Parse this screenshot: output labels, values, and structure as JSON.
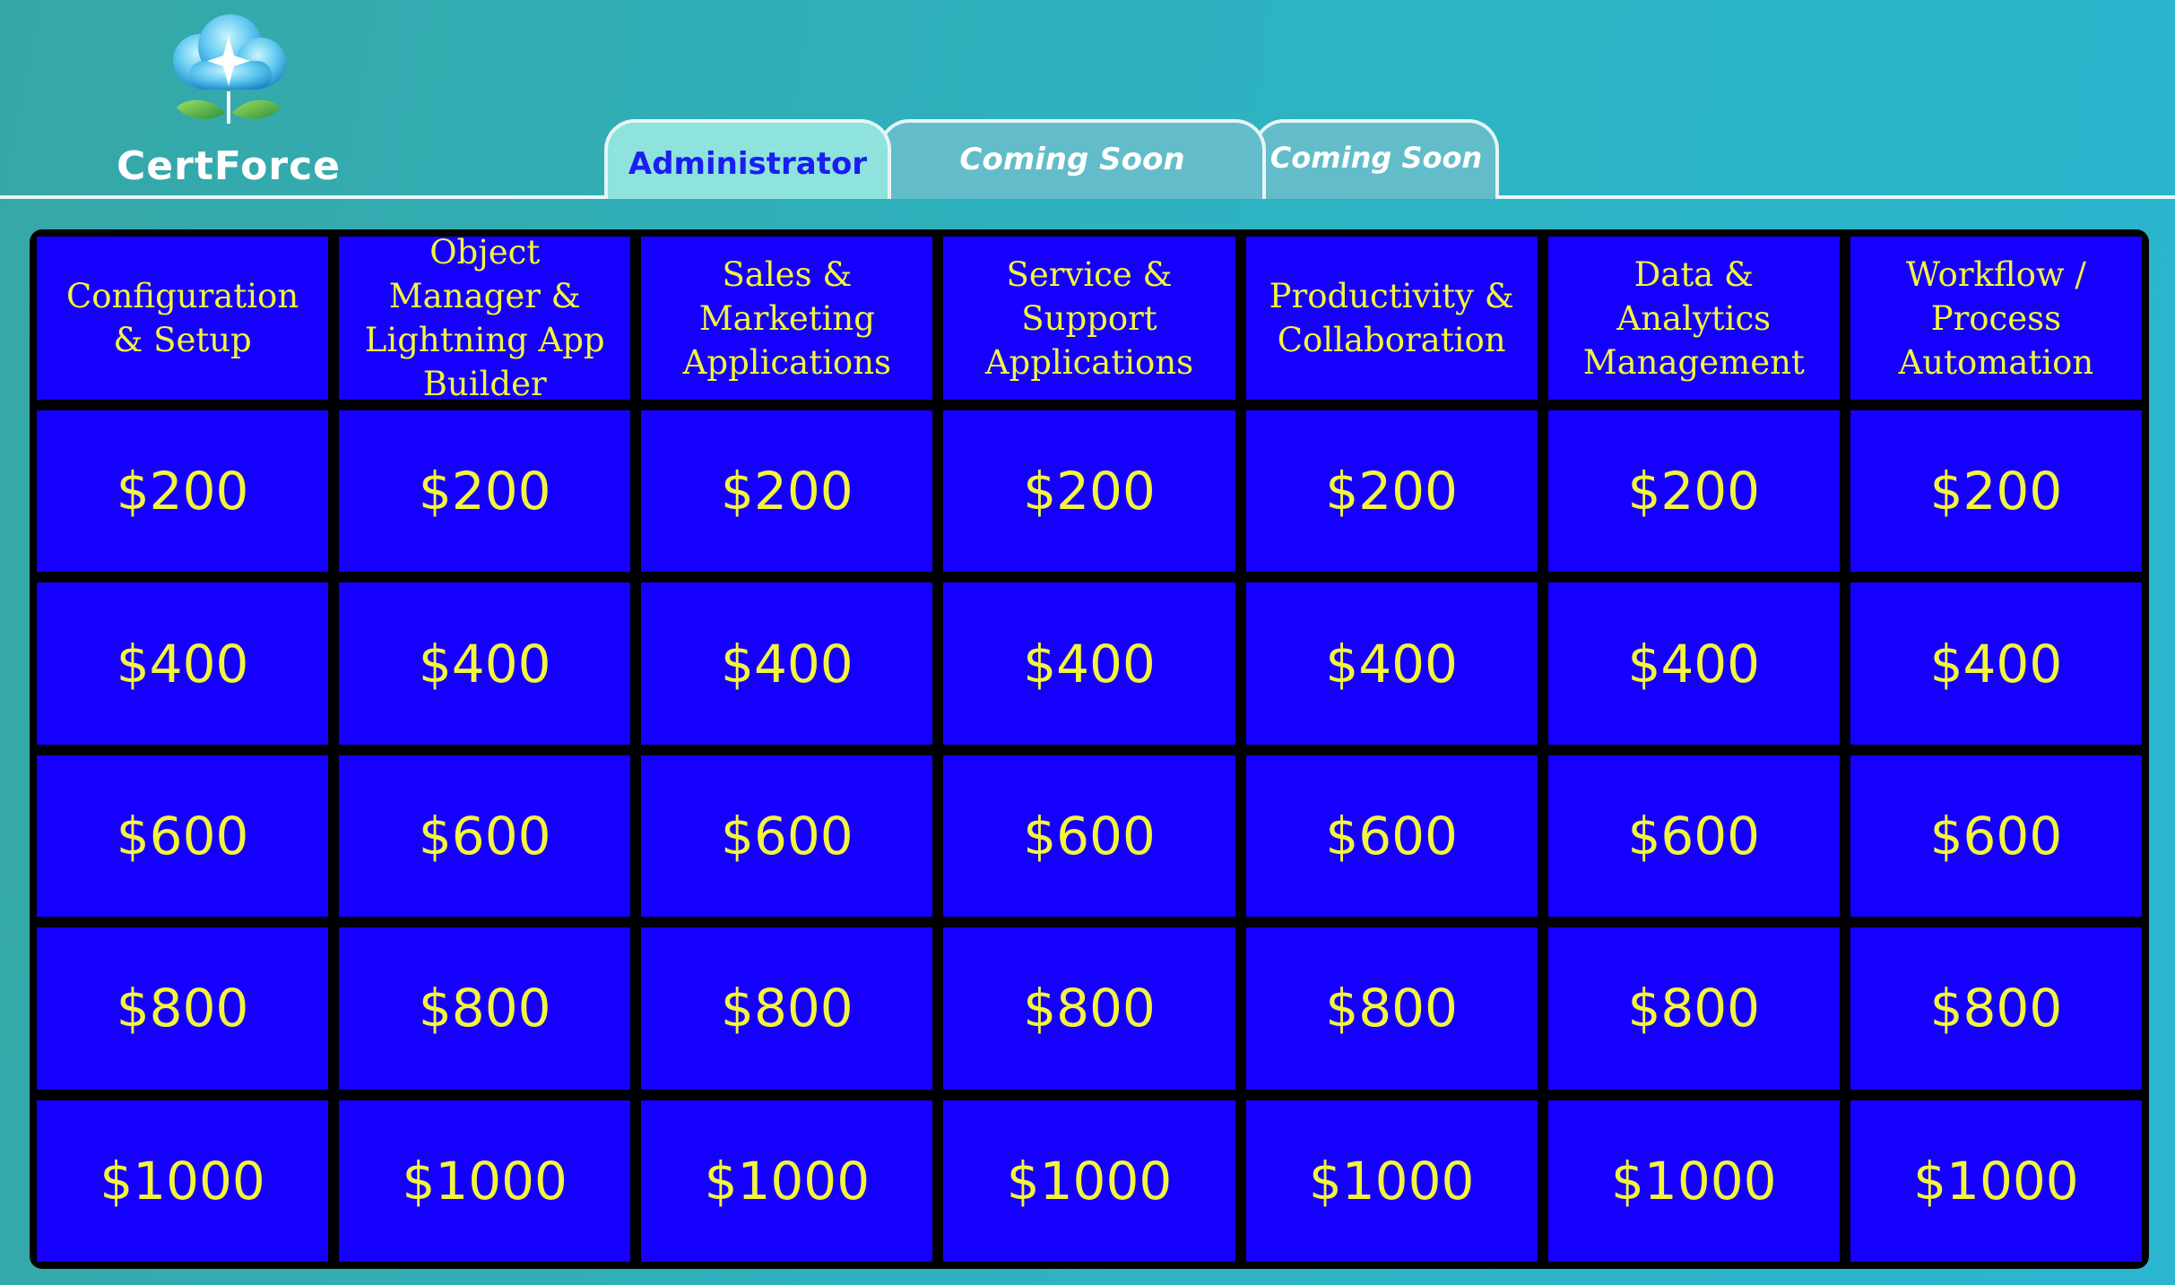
{
  "app": {
    "logo_text": "CertForce"
  },
  "tabs": [
    {
      "label": "Administrator",
      "active": true
    },
    {
      "label": "Coming Soon",
      "active": false
    },
    {
      "label": "Coming Soon",
      "active": false
    }
  ],
  "board": {
    "categories": [
      "Configuration & Setup",
      "Object Manager & Lightning App Builder",
      "Sales & Marketing Applications",
      "Service & Support Applications",
      "Productivity & Collaboration",
      "Data & Analytics Management",
      "Workflow / Process Automation"
    ],
    "rows": [
      [
        "$200",
        "$200",
        "$200",
        "$200",
        "$200",
        "$200",
        "$200"
      ],
      [
        "$400",
        "$400",
        "$400",
        "$400",
        "$400",
        "$400",
        "$400"
      ],
      [
        "$600",
        "$600",
        "$600",
        "$600",
        "$600",
        "$600",
        "$600"
      ],
      [
        "$800",
        "$800",
        "$800",
        "$800",
        "$800",
        "$800",
        "$800"
      ],
      [
        "$1000",
        "$1000",
        "$1000",
        "$1000",
        "$1000",
        "$1000",
        "$1000"
      ]
    ]
  },
  "colors": {
    "tile": "#1500ff",
    "tile_text": "#f4f53a",
    "grid_lines": "#000000",
    "active_tab": "#8fe3dd",
    "active_tab_text": "#1a1ef0",
    "inactive_tab": "#63bcc9"
  }
}
